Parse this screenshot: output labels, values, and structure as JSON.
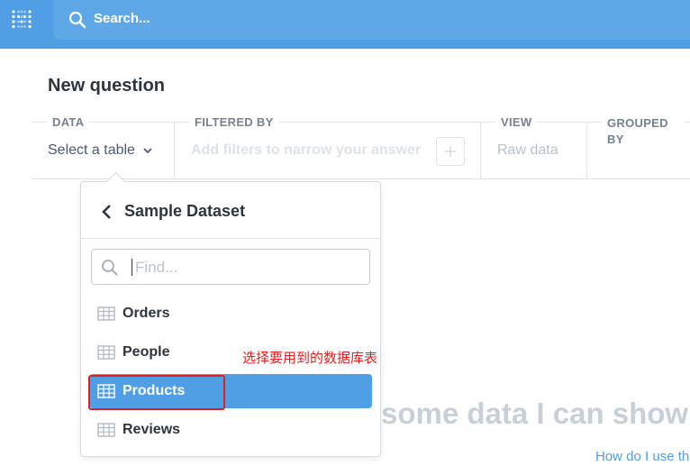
{
  "app": {
    "search_placeholder": "Search..."
  },
  "header": {
    "title": "New question"
  },
  "query_builder": {
    "data": {
      "legend": "DATA",
      "value": "Select a table"
    },
    "filtered_by": {
      "legend": "FILTERED BY",
      "placeholder": "Add filters to narrow your answer"
    },
    "view": {
      "legend": "VIEW",
      "value": "Raw data"
    },
    "grouped_by": {
      "legend": "GROUPED BY"
    }
  },
  "table_picker": {
    "database": "Sample Dataset",
    "find_placeholder": "Find...",
    "tables": [
      {
        "label": "Orders",
        "selected": false
      },
      {
        "label": "People",
        "selected": false
      },
      {
        "label": "Products",
        "selected": true
      },
      {
        "label": "Reviews",
        "selected": false
      }
    ]
  },
  "annotation": {
    "text": "选择要用到的数据库表",
    "color": "#e02020"
  },
  "empty_state": {
    "headline": "some data I can show",
    "help_link": "How do I use th"
  },
  "colors": {
    "brand": "#509ee3",
    "muted": "#74838f"
  }
}
